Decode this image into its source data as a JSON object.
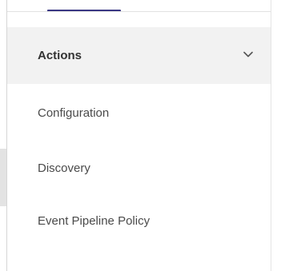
{
  "panel": {
    "section": {
      "title": "Actions",
      "icon": "chevron-down-icon"
    },
    "items": [
      {
        "label": "Configuration"
      },
      {
        "label": "Discovery"
      },
      {
        "label": "Event Pipeline Policy"
      }
    ]
  },
  "colors": {
    "tab_indicator": "#3a3784",
    "section_background": "#f2f2f2",
    "text": "#4a4a4a"
  }
}
